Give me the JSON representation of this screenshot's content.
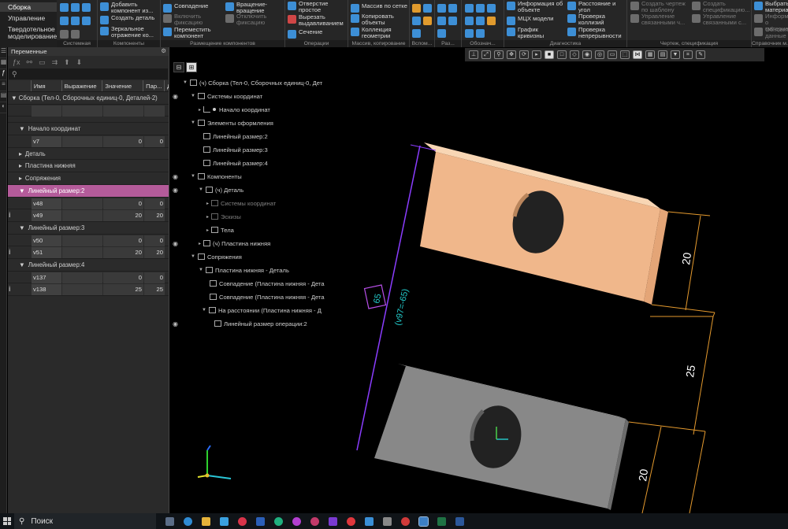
{
  "ribbon": {
    "modes": [
      {
        "label": "Сборка",
        "active": true
      },
      {
        "label": "Управление",
        "active": false
      },
      {
        "label": "Твердотельное моделирование",
        "active": false
      }
    ],
    "groups": [
      {
        "label": "Системная",
        "buttons": []
      },
      {
        "label": "Компоненты",
        "buttons": [
          "Добавить компонент из...",
          "Создать деталь",
          "Зеркальное отражение ко..."
        ]
      },
      {
        "label": "Размещение компонентов",
        "buttons": [
          "Совпадение",
          "Включить фиксацию",
          "Переместить компонент",
          "Вращение-вращение",
          "Отключить фиксацию"
        ]
      },
      {
        "label": "Операции",
        "buttons": [
          "Отверстие простое",
          "Вырезать выдавливанием",
          "Сечение"
        ]
      },
      {
        "label": "Массив, копирование",
        "buttons": [
          "Массив по сетке",
          "Копировать объекты",
          "Коллекция геометрии"
        ]
      },
      {
        "label": "Вспом...",
        "buttons": []
      },
      {
        "label": "Раз...",
        "buttons": []
      },
      {
        "label": "Обознач...",
        "buttons": []
      },
      {
        "label": "Диагностика",
        "buttons": [
          "Информация об объекте",
          "МЦХ модели",
          "График кривизны",
          "Расстояние и угол",
          "Проверка коллизий",
          "Проверка непрерывности"
        ]
      },
      {
        "label": "Чертеж, спецификация",
        "buttons": [
          "Создать чертеж по шаблону",
          "Управление связанными ч...",
          "Создать спецификацию...",
          "Управление связанными с..."
        ]
      },
      {
        "label": "Справочник м...",
        "buttons": [
          "Выбрать материал",
          "Информация о материале",
          "Обновить данные из..."
        ]
      }
    ]
  },
  "variables_panel": {
    "title": "Переменные",
    "search_icon": "search-icon",
    "columns": [
      "Имя",
      "Выражение",
      "Значение",
      "Пар...",
      "Д"
    ],
    "root_label": "Сборка (Тел-0, Сборочных единиц-0, Деталей-2)",
    "groups": [
      {
        "label": "Начало координат",
        "rows": [
          {
            "name": "v7",
            "value": "0",
            "param": "0"
          }
        ]
      },
      {
        "label": "Деталь",
        "rows": []
      },
      {
        "label": "Пластина нижняя",
        "rows": []
      },
      {
        "label": "Сопряжения",
        "rows": []
      },
      {
        "label": "Линейный размер:2",
        "selected": true,
        "rows": [
          {
            "name": "v48",
            "value": "0",
            "param": "0",
            "info": false
          },
          {
            "name": "v49",
            "value": "20",
            "param": "20",
            "info": true
          }
        ]
      },
      {
        "label": "Линейный размер:3",
        "rows": [
          {
            "name": "v50",
            "value": "0",
            "param": "0",
            "info": false
          },
          {
            "name": "v51",
            "value": "20",
            "param": "20",
            "info": true
          }
        ]
      },
      {
        "label": "Линейный размер:4",
        "rows": [
          {
            "name": "v137",
            "value": "0",
            "param": "0",
            "info": false
          },
          {
            "name": "v138",
            "value": "25",
            "param": "25",
            "info": true
          }
        ]
      }
    ]
  },
  "tree": [
    {
      "label": "(ч) Сборка (Тел-0, Сборочных единиц-0, Дет",
      "level": 0,
      "eye": false,
      "arrow": "▼"
    },
    {
      "label": "Системы координат",
      "level": 1,
      "eye": true,
      "arrow": "▼"
    },
    {
      "label": "Начало координат",
      "level": 2,
      "eye": false,
      "arrow": "▸"
    },
    {
      "label": "Элементы оформления",
      "level": 1,
      "eye": false,
      "arrow": "▼"
    },
    {
      "label": "Линейный размер:2",
      "level": 2,
      "eye": false,
      "arrow": ""
    },
    {
      "label": "Линейный размер:3",
      "level": 2,
      "eye": false,
      "arrow": ""
    },
    {
      "label": "Линейный размер:4",
      "level": 2,
      "eye": false,
      "arrow": ""
    },
    {
      "label": "Компоненты",
      "level": 1,
      "eye": true,
      "arrow": "▼"
    },
    {
      "label": "(ч) Деталь",
      "level": 2,
      "eye": true,
      "arrow": "▼"
    },
    {
      "label": "Системы координат",
      "level": 3,
      "eye": false,
      "arrow": "▸",
      "dim": true
    },
    {
      "label": "Эскизы",
      "level": 3,
      "eye": false,
      "arrow": "▸",
      "dim": true
    },
    {
      "label": "Тела",
      "level": 3,
      "eye": false,
      "arrow": "▸"
    },
    {
      "label": "(ч) Пластина нижняя",
      "level": 2,
      "eye": true,
      "arrow": "▸"
    },
    {
      "label": "Сопряжения",
      "level": 1,
      "eye": false,
      "arrow": "▼"
    },
    {
      "label": "Пластина нижняя - Деталь",
      "level": 2,
      "eye": false,
      "arrow": "▼"
    },
    {
      "label": "Совпадение (Пластина нижняя  -  Дета",
      "level": 3,
      "eye": false,
      "arrow": ""
    },
    {
      "label": "Совпадение (Пластина нижняя  -  Дета",
      "level": 3,
      "eye": false,
      "arrow": ""
    },
    {
      "label": "На расстоянии (Пластина нижняя  -  Д",
      "level": 3,
      "eye": false,
      "arrow": "▼"
    },
    {
      "label": "Линейный размер операции:2",
      "level": 4,
      "eye": true,
      "arrow": ""
    }
  ],
  "viewport": {
    "dimensions": [
      "20",
      "25",
      "20"
    ],
    "inclined_dimension": "(v97=-65)",
    "boxed_value": "65",
    "top_part_color": "#f2b98c",
    "bottom_part_color": "#8a8a8a",
    "dimension_color": "#e59a2e",
    "cyan_color": "#22c9c9",
    "purple_color": "#8b3dff"
  },
  "taskbar": {
    "search_label": "Поиск"
  }
}
